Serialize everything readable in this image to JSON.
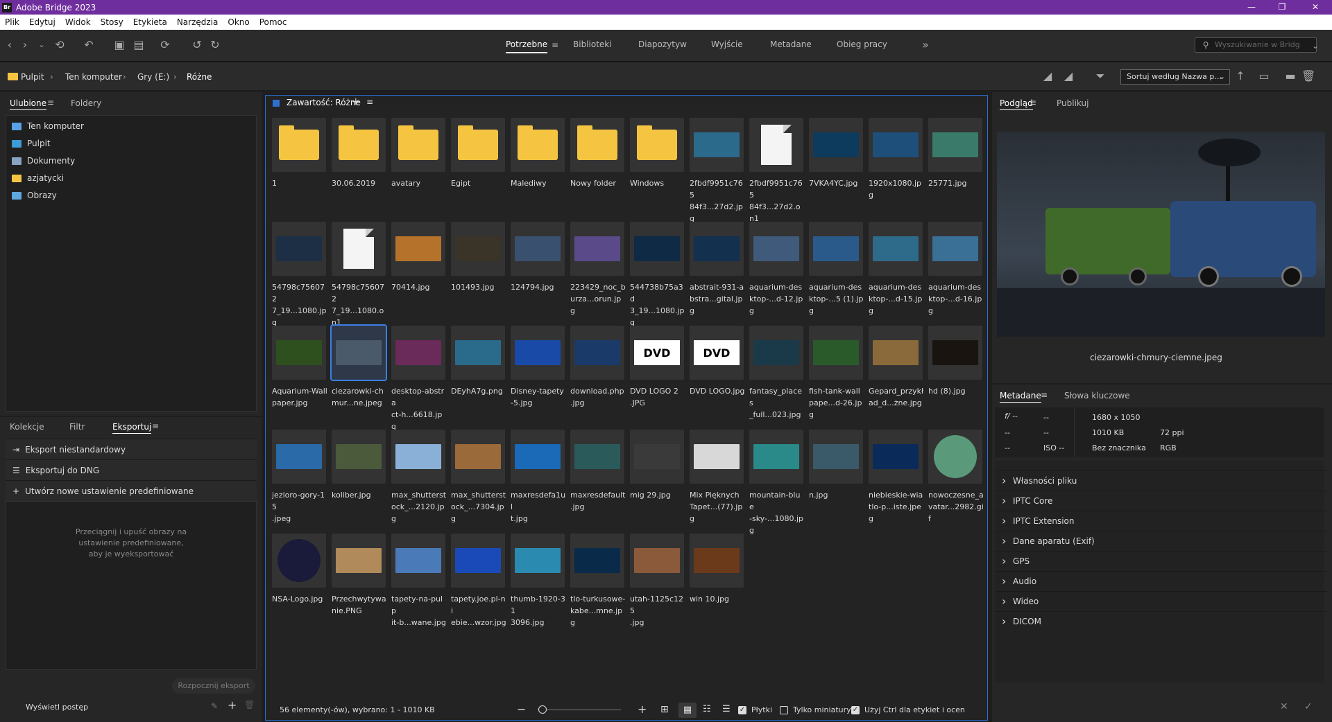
{
  "app": {
    "title": "Adobe Bridge 2023",
    "logo": "Br"
  },
  "menu": [
    "Plik",
    "Edytuj",
    "Widok",
    "Stosy",
    "Etykieta",
    "Narzędzia",
    "Okno",
    "Pomoc"
  ],
  "workspaces": [
    "Potrzebne",
    "Biblioteki",
    "Diapozytyw",
    "Wyjście",
    "Metadane",
    "Obieg pracy"
  ],
  "search": {
    "placeholder": "Wyszukiwanie w Bridg"
  },
  "breadcrumb": [
    "Pulpit",
    "Ten komputer",
    "Gry (E:)",
    "Różne"
  ],
  "sort_label": "Sortuj według Nazwa p...",
  "left_top": {
    "tabs": [
      "Ulubione",
      "Foldery"
    ],
    "favorites": [
      {
        "label": "Ten komputer",
        "color": "#5aa0e6"
      },
      {
        "label": "Pulpit",
        "color": "#3d9bd8"
      },
      {
        "label": "Dokumenty",
        "color": "#8aa3c2"
      },
      {
        "label": "azjatycki",
        "color": "#f5c542"
      },
      {
        "label": "Obrazy",
        "color": "#5fa7df"
      }
    ]
  },
  "left_bottom": {
    "tabs": [
      "Kolekcje",
      "Filtr",
      "Eksportuj"
    ],
    "items": [
      "Eksport niestandardowy",
      "Eksportuj do DNG",
      "Utwórz nowe ustawienie predefiniowane"
    ],
    "hint": [
      "Przeciągnij i upuść obrazy na",
      "ustawienie predefiniowane,",
      "aby je wyeksportować"
    ],
    "start_export": "Rozpocznij eksport",
    "progress": "Wyświetl postęp"
  },
  "content": {
    "title": "Zawartość: Różne",
    "status": "56 elementy(-ów), wybrano: 1 - 1010 KB",
    "check_tiles": "Płytki",
    "check_thumbs": "Tylko miniatury",
    "check_ctrl": "Użyj Ctrl dla etykiet i ocen",
    "rows": [
      [
        {
          "kind": "folder",
          "label": [
            "1",
            ""
          ]
        },
        {
          "kind": "folder",
          "label": [
            "30.06.2019",
            ""
          ]
        },
        {
          "kind": "folder",
          "label": [
            "avatary",
            ""
          ]
        },
        {
          "kind": "folder",
          "label": [
            "Egipt",
            ""
          ]
        },
        {
          "kind": "folder",
          "label": [
            "Malediwy",
            ""
          ]
        },
        {
          "kind": "folder",
          "label": [
            "Nowy folder",
            ""
          ]
        },
        {
          "kind": "folder",
          "label": [
            "Windows",
            ""
          ]
        },
        {
          "kind": "img",
          "color": "#2b6a8a",
          "label": [
            "2fbdf9951c765",
            "84f3...27d2.jpg"
          ]
        },
        {
          "kind": "doc",
          "label": [
            "2fbdf9951c765",
            "84f3...27d2.on1"
          ]
        },
        {
          "kind": "img",
          "color": "#0d3b5e",
          "label": [
            "7VKA4YC.jpg",
            ""
          ]
        },
        {
          "kind": "img",
          "color": "#1e4f7a",
          "label": [
            "1920x1080.jpg",
            ""
          ]
        },
        {
          "kind": "img",
          "color": "#3a7a6a",
          "label": [
            "25771.jpg",
            ""
          ]
        }
      ],
      [
        {
          "kind": "img",
          "color": "#1c2f44",
          "label": [
            "54798c756072",
            "7_19...1080.jpg"
          ]
        },
        {
          "kind": "doc",
          "label": [
            "54798c756072",
            "7_19...1080.on1"
          ]
        },
        {
          "kind": "img",
          "color": "#b5722a",
          "label": [
            "70414.jpg",
            ""
          ]
        },
        {
          "kind": "img",
          "color": "#3a3328",
          "label": [
            "101493.jpg",
            ""
          ]
        },
        {
          "kind": "img",
          "color": "#39506e",
          "label": [
            "124794.jpg",
            ""
          ]
        },
        {
          "kind": "img",
          "color": "#5a4a8a",
          "label": [
            "223429_noc_b",
            "urza...orun.jpg"
          ]
        },
        {
          "kind": "img",
          "color": "#0f2a45",
          "label": [
            "544738b75a3d",
            "3_19...1080.jpg"
          ]
        },
        {
          "kind": "img",
          "color": "#13304f",
          "label": [
            "abstrait-931-a",
            "bstra...gital.jpg"
          ]
        },
        {
          "kind": "img",
          "color": "#3f5a7a",
          "label": [
            "aquarium-des",
            "ktop-...d-12.jpg"
          ]
        },
        {
          "kind": "img",
          "color": "#2a5a8a",
          "label": [
            "aquarium-des",
            "ktop-...5 (1).jpg"
          ]
        },
        {
          "kind": "img",
          "color": "#2e6a8a",
          "label": [
            "aquarium-des",
            "ktop-...d-15.jpg"
          ]
        },
        {
          "kind": "img",
          "color": "#3a6f96",
          "label": [
            "aquarium-des",
            "ktop-...d-16.jpg"
          ]
        }
      ],
      [
        {
          "kind": "img",
          "color": "#2e4f1e",
          "label": [
            "Aquarium-Wall",
            "paper.jpg"
          ]
        },
        {
          "kind": "img",
          "color": "#4a5a6a",
          "label": [
            "ciezarowki-ch",
            "mur...ne.jpeg"
          ],
          "selected": true
        },
        {
          "kind": "img",
          "color": "#6a2a5a",
          "label": [
            "desktop-abstra",
            "ct-h...6618.jpg"
          ]
        },
        {
          "kind": "img",
          "color": "#2a6a8a",
          "label": [
            "DEyhA7g.png",
            ""
          ]
        },
        {
          "kind": "img",
          "color": "#1a4aa8",
          "label": [
            "Disney-tapety",
            "-5.jpg"
          ]
        },
        {
          "kind": "img",
          "color": "#1a3a6a",
          "label": [
            "download.php",
            ".jpg"
          ]
        },
        {
          "kind": "dvd",
          "text": "DVD",
          "label": [
            "DVD LOGO 2",
            ".JPG"
          ]
        },
        {
          "kind": "dvd",
          "text": "DVD",
          "label": [
            "DVD LOGO.jpg",
            ""
          ]
        },
        {
          "kind": "img",
          "color": "#1a3a4a",
          "label": [
            "fantasy_places",
            "_full...023.jpg"
          ]
        },
        {
          "kind": "img",
          "color": "#2a5a2a",
          "label": [
            "fish-tank-wall",
            "pape...d-26.jpg"
          ]
        },
        {
          "kind": "img",
          "color": "#8a6a3a",
          "label": [
            "Gepard_przykł",
            "ad_d...żne.jpg"
          ]
        },
        {
          "kind": "img",
          "color": "#1a1410",
          "label": [
            "hd (8).jpg",
            ""
          ]
        }
      ],
      [
        {
          "kind": "img",
          "color": "#2a6aa8",
          "label": [
            "jezioro-gory-15",
            ".jpeg"
          ]
        },
        {
          "kind": "img",
          "color": "#4a5a3a",
          "label": [
            "koliber.jpg",
            ""
          ]
        },
        {
          "kind": "img",
          "color": "#8ab0d8",
          "label": [
            "max_shutterst",
            "ock_...2120.jpg"
          ]
        },
        {
          "kind": "img",
          "color": "#9a6a3a",
          "label": [
            "max_shutterst",
            "ock_...7304.jpg"
          ]
        },
        {
          "kind": "img",
          "color": "#1a6ab8",
          "label": [
            "maxresdefa1ul",
            "t.jpg"
          ]
        },
        {
          "kind": "img",
          "color": "#2a5a5a",
          "label": [
            "maxresdefault",
            ".jpg"
          ]
        },
        {
          "kind": "img",
          "color": "#3a3a3a",
          "label": [
            "mig 29.jpg",
            ""
          ]
        },
        {
          "kind": "img",
          "color": "#d8d8d8",
          "label": [
            "Mix Pięknych",
            "Tapet...(77).jpg"
          ]
        },
        {
          "kind": "img",
          "color": "#2a8a8a",
          "label": [
            "mountain-blue",
            "-sky-...1080.jpg"
          ]
        },
        {
          "kind": "img",
          "color": "#3a5a6a",
          "label": [
            "n.jpg",
            ""
          ]
        },
        {
          "kind": "img",
          "color": "#0a2a5a",
          "label": [
            "niebieskie-wia",
            "tlo-p...iste.jpeg"
          ]
        },
        {
          "kind": "round",
          "color": "#5a9a7a",
          "label": [
            "nowoczesne_a",
            "vatar...2982.gif"
          ]
        }
      ],
      [
        {
          "kind": "round",
          "color": "#1a1a3a",
          "label": [
            "NSA-Logo.jpg",
            ""
          ]
        },
        {
          "kind": "img",
          "color": "#b08a5a",
          "label": [
            "Przechwytywa",
            "nie.PNG"
          ]
        },
        {
          "kind": "img",
          "color": "#4a7ab8",
          "label": [
            "tapety-na-pulp",
            "it-b...wane.jpg"
          ]
        },
        {
          "kind": "img",
          "color": "#1a4ab8",
          "label": [
            "tapety.joe.pl-ni",
            "ebie...wzor.jpg"
          ]
        },
        {
          "kind": "img",
          "color": "#2a8ab0",
          "label": [
            "thumb-1920-31",
            "3096.jpg"
          ]
        },
        {
          "kind": "img",
          "color": "#0a2a4a",
          "label": [
            "tlo-turkusowe-",
            "kabe...mne.jpg"
          ]
        },
        {
          "kind": "img",
          "color": "#8a5a3a",
          "label": [
            "utah-1125c125",
            ".jpg"
          ]
        },
        {
          "kind": "img",
          "color": "#6a3a1a",
          "label": [
            "win 10.jpg",
            ""
          ]
        }
      ]
    ]
  },
  "preview": {
    "tabs": [
      "Podgląd",
      "Publikuj"
    ],
    "filename": "ciezarowki-chmury-ciemne.jpeg",
    "colors": {
      "sky": "#3a4450",
      "truck_green": "#3f6a2a",
      "truck_blue": "#2a4a7a"
    }
  },
  "metadata": {
    "tabs": [
      "Metadane",
      "Słowa kluczowe"
    ],
    "grid": {
      "aperture": "f/ --",
      "shutter": "--",
      "r2c1": "--",
      "r2c2": "--",
      "r3c1": "--",
      "iso": "ISO --",
      "dims": "1680 x 1050",
      "size": "1010 KB",
      "ppi": "72 ppi",
      "label": "Bez znacznika",
      "mode": "RGB"
    },
    "sections": [
      "Własności pliku",
      "IPTC Core",
      "IPTC Extension",
      "Dane aparatu (Exif)",
      "GPS",
      "Audio",
      "Wideo",
      "DICOM"
    ]
  }
}
